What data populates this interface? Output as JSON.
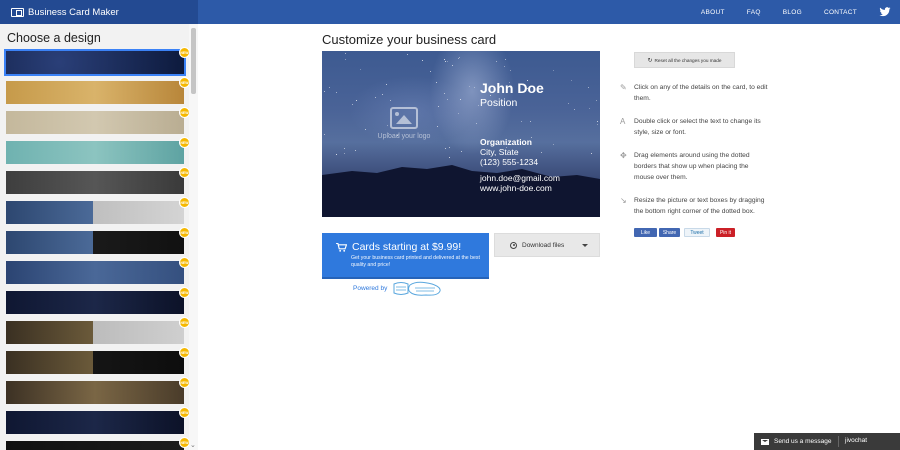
{
  "header": {
    "brand": "Business Card Maker",
    "nav": [
      "ABOUT",
      "FAQ",
      "BLOG",
      "CONTACT"
    ],
    "accent": "#2d5aa8"
  },
  "sidebar": {
    "title": "Choose a design",
    "badge": "NEW",
    "thumbnails": [
      {
        "style": "starry-navy"
      },
      {
        "style": "gold"
      },
      {
        "style": "taupe"
      },
      {
        "style": "teal"
      },
      {
        "style": "charcoal"
      },
      {
        "style": "sky-split-gray"
      },
      {
        "style": "sky-split-black"
      },
      {
        "style": "sky-meteor"
      },
      {
        "style": "night-dark"
      },
      {
        "style": "city-split-gray"
      },
      {
        "style": "city-split-black"
      },
      {
        "style": "city-lights"
      },
      {
        "style": "night-dark"
      },
      {
        "style": "black"
      }
    ]
  },
  "main": {
    "title": "Customize your business card",
    "card": {
      "logo_placeholder": "Upload your logo",
      "name": "John Doe",
      "position": "Position",
      "organization": "Organization",
      "city": "City, State",
      "phone": "(123) 555-1234",
      "email": "john.doe@gmail.com",
      "website": "www.john-doe.com"
    },
    "order_button": {
      "label": "Cards starting at $9.99!",
      "sub": "Get your business card printed and delivered at the best quality and price!"
    },
    "download_button": "Download files",
    "powered_by": "Powered by"
  },
  "side_panel": {
    "reset_button": "Reset all the changes you made",
    "tips": [
      {
        "icon": "edit-icon",
        "text": "Click on any of the details on the card, to edit them."
      },
      {
        "icon": "text-style-icon",
        "text": "Double click or select the text to change its style, size or font."
      },
      {
        "icon": "move-icon",
        "text": "Drag elements around using the dotted borders that show up when placing the mouse over them."
      },
      {
        "icon": "resize-icon",
        "text": "Resize the picture or text boxes by dragging the bottom right corner of the dotted box."
      }
    ],
    "social": {
      "like": "Like",
      "share": "Share",
      "tweet": "Tweet",
      "pin": "Pin it"
    }
  },
  "chat": {
    "label": "Send us a message",
    "brand": "jivochat"
  }
}
